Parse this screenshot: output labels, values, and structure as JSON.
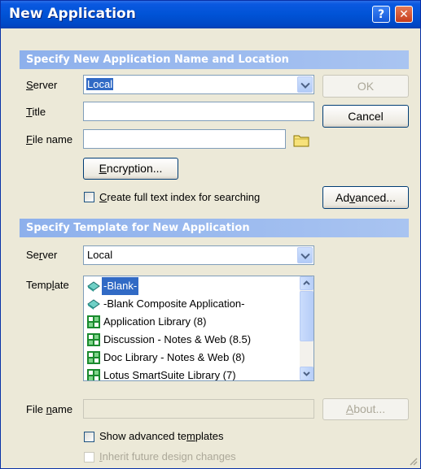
{
  "window": {
    "title": "New Application",
    "help_label": "?",
    "close_label": "✕"
  },
  "section1": {
    "title": "Specify New Application Name and Location"
  },
  "server_label": {
    "u": "S",
    "rest": "erver"
  },
  "server_value": "Local",
  "title_label": {
    "u": "T",
    "rest": "itle"
  },
  "title_value": "",
  "filename_label": {
    "u": "F",
    "rest": "ile name"
  },
  "filename_value": "",
  "encryption_button": {
    "u": "E",
    "rest": "ncryption..."
  },
  "fulltext_checkbox": {
    "u": "C",
    "rest": "reate full text index for searching",
    "checked": false
  },
  "ok_button": "OK",
  "cancel_button": "Cancel",
  "advanced_button": {
    "pre": "Ad",
    "u": "v",
    "rest": "anced..."
  },
  "section2": {
    "title": "Specify Template for New Application"
  },
  "template_server_label": {
    "pre": "Se",
    "u": "r",
    "rest": "ver"
  },
  "template_server_value": "Local",
  "template_label": {
    "pre": "Temp",
    "u": "l",
    "rest": "ate"
  },
  "templates": [
    {
      "label": "-Blank-",
      "icon": "blank-db-icon",
      "selected": true
    },
    {
      "label": "-Blank Composite Application-",
      "icon": "blank-db-icon",
      "selected": false
    },
    {
      "label": "Application Library (8)",
      "icon": "notes-app-icon",
      "selected": false
    },
    {
      "label": "Discussion - Notes & Web (8.5)",
      "icon": "notes-app-icon",
      "selected": false
    },
    {
      "label": "Doc Library - Notes & Web (8)",
      "icon": "notes-app-icon",
      "selected": false
    },
    {
      "label": "Lotus SmartSuite Library (7)",
      "icon": "notes-app-icon",
      "selected": false
    }
  ],
  "template_filename_label": {
    "pre": "File ",
    "u": "n",
    "rest": "ame"
  },
  "template_filename_value": "",
  "about_button": {
    "u": "A",
    "rest": "bout..."
  },
  "show_advanced_checkbox": {
    "pre": "Show advanced te",
    "u": "m",
    "rest": "plates",
    "checked": false
  },
  "inherit_checkbox": {
    "u": "I",
    "rest": "nherit future design changes",
    "checked": false,
    "disabled": true
  },
  "colors": {
    "title_bar": "#0053d6",
    "section_header": "#8db0ec",
    "selection": "#316ac5"
  }
}
